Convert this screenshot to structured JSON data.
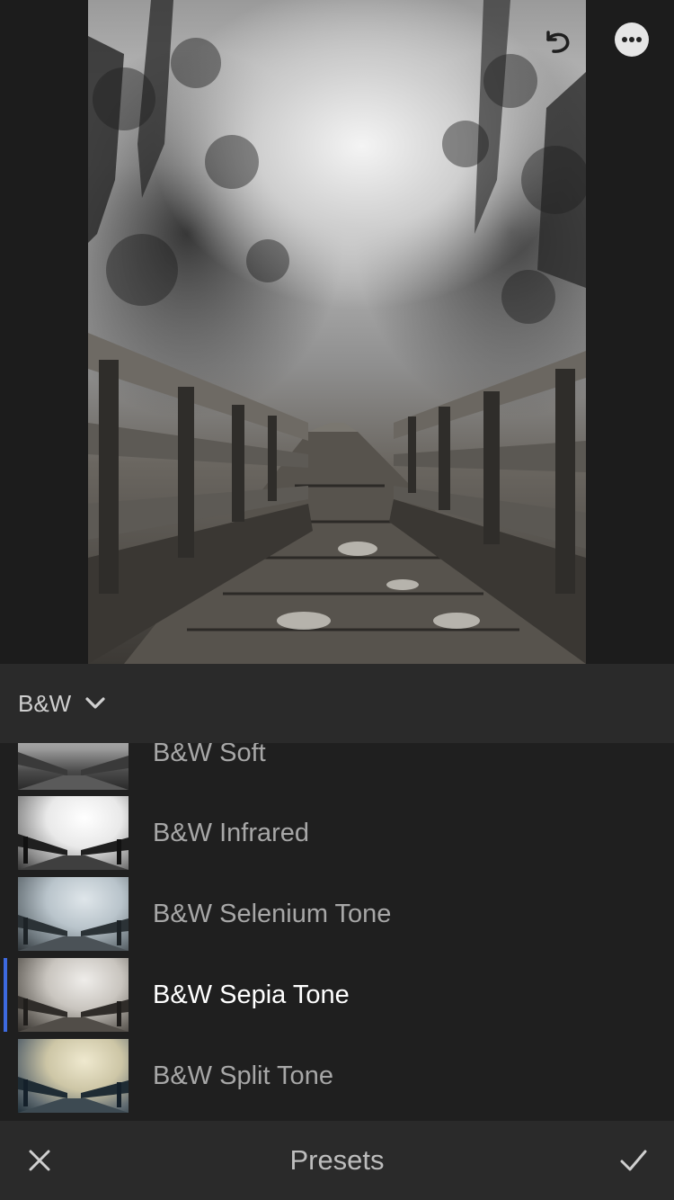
{
  "group": {
    "label": "B&W"
  },
  "presets": [
    {
      "label": "B&W Soft",
      "tone": "soft"
    },
    {
      "label": "B&W Infrared",
      "tone": "infrared"
    },
    {
      "label": "B&W Selenium Tone",
      "tone": "selenium"
    },
    {
      "label": "B&W Sepia Tone",
      "tone": "sepia",
      "selected": true
    },
    {
      "label": "B&W Split Tone",
      "tone": "split"
    }
  ],
  "bottom_bar": {
    "title": "Presets"
  },
  "colors": {
    "accent": "#3d6ae0",
    "background": "#1f1f1f",
    "panel": "#2a2a2a"
  },
  "icons": {
    "undo": "undo-icon",
    "more": "more-icon",
    "chevron": "chevron-down-icon",
    "close": "close-icon",
    "confirm": "checkmark-icon"
  }
}
